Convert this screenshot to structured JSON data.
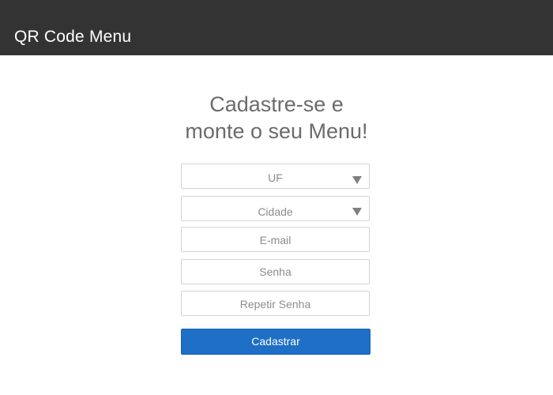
{
  "header": {
    "title": "QR Code Menu",
    "background": "#333333"
  },
  "form": {
    "heading_line1": "Cadastre-se e",
    "heading_line2": "monte o seu Menu!",
    "uf": {
      "selected": "UF",
      "icon": "chevron-down-icon"
    },
    "cidade": {
      "selected": "Cidade",
      "icon": "chevron-down-icon"
    },
    "email": {
      "placeholder": "E-mail"
    },
    "senha": {
      "placeholder": "Senha"
    },
    "repetir_senha": {
      "placeholder": "Repetir Senha"
    },
    "submit_label": "Cadastrar",
    "accent": "#1e6fc6"
  }
}
